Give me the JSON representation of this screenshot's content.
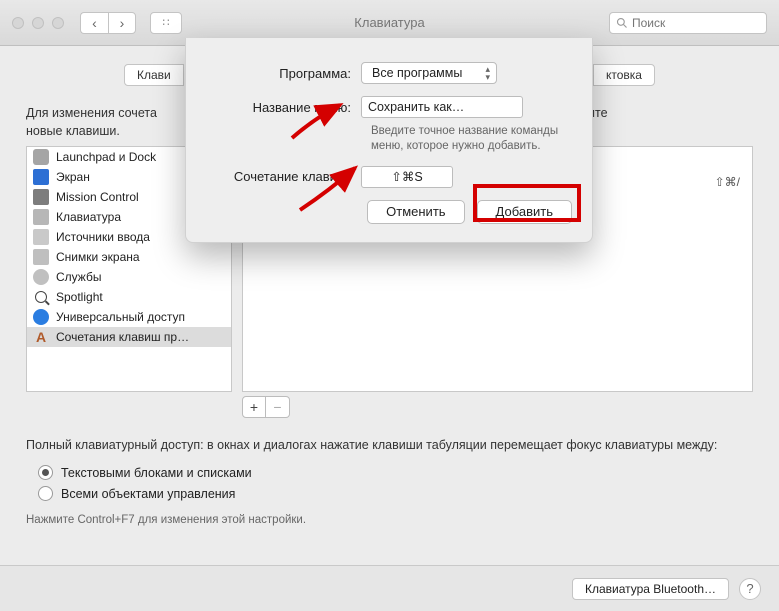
{
  "window": {
    "title": "Клавиатура",
    "search_placeholder": "Поиск"
  },
  "tabs": {
    "left_fragment": "Клави",
    "right_fragment": "ктовка"
  },
  "intro_line1": "Для изменения сочета",
  "intro_line2": "новые клавиши.",
  "intro_right_fragment": "м введите",
  "sidebar": {
    "items": [
      {
        "label": "Launchpad и Dock",
        "icon": "launchpad"
      },
      {
        "label": "Экран",
        "icon": "screen"
      },
      {
        "label": "Mission Control",
        "icon": "mission"
      },
      {
        "label": "Клавиатура",
        "icon": "keyboard"
      },
      {
        "label": "Источники ввода",
        "icon": "input"
      },
      {
        "label": "Снимки экрана",
        "icon": "screenshot"
      },
      {
        "label": "Службы",
        "icon": "services"
      },
      {
        "label": "Spotlight",
        "icon": "spotlight"
      },
      {
        "label": "Универсальный доступ",
        "icon": "accessibility"
      },
      {
        "label": "Сочетания клавиш пр…",
        "icon": "appshort",
        "selected": true
      }
    ]
  },
  "right_shortcut_hint": "⇧⌘/",
  "addremove": {
    "add": "+",
    "remove": "−"
  },
  "fka": {
    "desc": "Полный клавиатурный доступ: в окнах и диалогах нажатие клавиши табуляции перемещает фокус клавиатуры между:",
    "opt1": "Текстовыми блоками и списками",
    "opt2": "Всеми объектами управления",
    "hint": "Нажмите Control+F7 для изменения этой настройки."
  },
  "footer": {
    "bluetooth": "Клавиатура Bluetooth…",
    "help": "?"
  },
  "sheet": {
    "app_label": "Программа:",
    "app_value": "Все программы",
    "menu_label": "Название меню:",
    "menu_value": "Сохранить как…",
    "menu_help": "Введите точное название команды меню, которое нужно добавить.",
    "shortcut_label": "Сочетание клавиш:",
    "shortcut_value": "⇧⌘S",
    "cancel": "Отменить",
    "add": "Добавить"
  }
}
